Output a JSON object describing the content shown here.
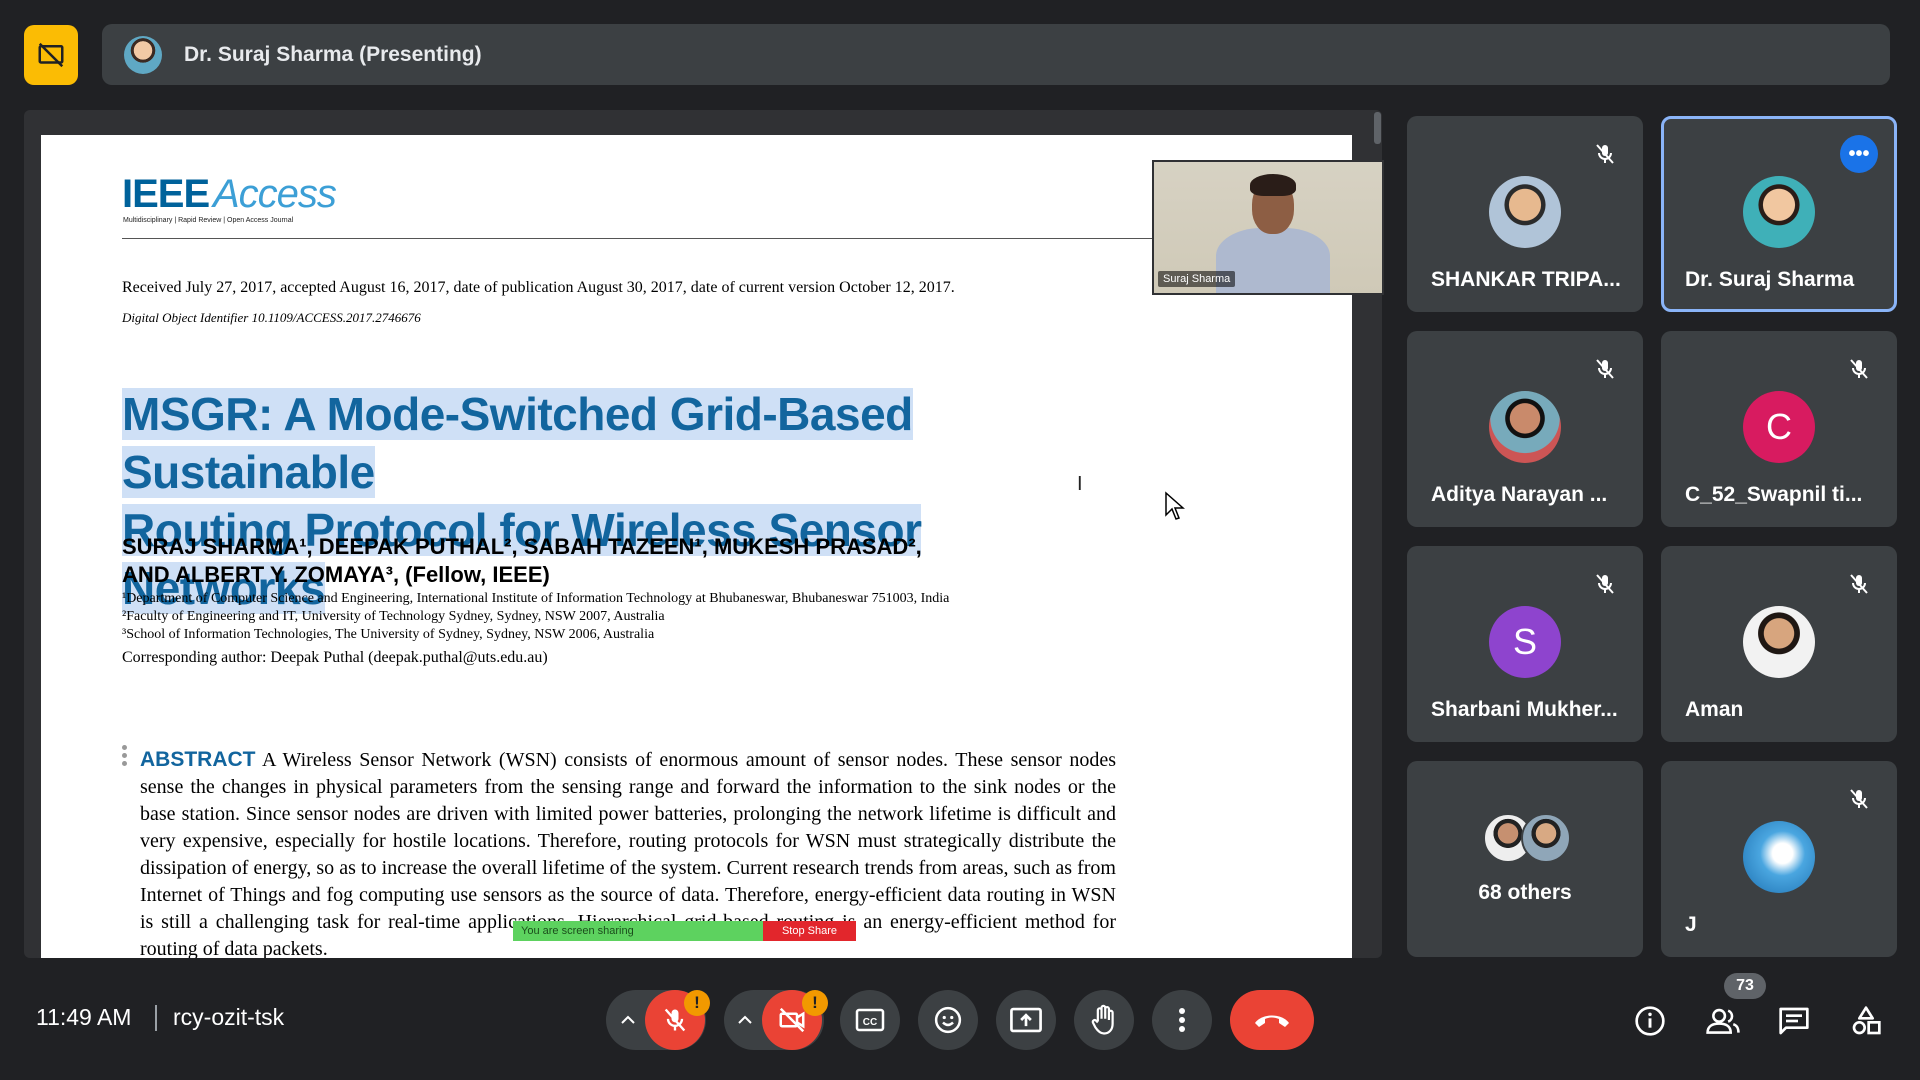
{
  "presenter": {
    "label": "Dr. Suraj Sharma (Presenting)"
  },
  "document": {
    "logo_ieee": "IEEE",
    "logo_access": "Access",
    "logo_tagline": "Multidisciplinary | Rapid Review | Open Access Journal",
    "received": "Received July 27, 2017, accepted August 16, 2017, date of publication August 30, 2017, date of current version October 12, 2017.",
    "doi": "Digital Object Identifier 10.1109/ACCESS.2017.2746676",
    "title_line1": "MSGR: A Mode-Switched Grid-Based Sustainable",
    "title_line2": "Routing Protocol for Wireless Sensor Networks",
    "authors_line1": "SURAJ SHARMA¹, DEEPAK PUTHAL², SABAH TAZEEN¹, MUKESH PRASAD²,",
    "authors_line2": "AND ALBERT Y. ZOMAYA³, (Fellow, IEEE)",
    "affiliations": [
      "¹Department of Computer Science and Engineering, International Institute of Information Technology at Bhubaneswar, Bhubaneswar 751003, India",
      "²Faculty of Engineering and IT, University of Technology Sydney, Sydney, NSW 2007, Australia",
      "³School of Information Technologies, The University of Sydney, Sydney, NSW 2006, Australia"
    ],
    "corresponding": "Corresponding author: Deepak Puthal (deepak.puthal@uts.edu.au)",
    "abstract_heading": "ABSTRACT",
    "abstract_text": "A Wireless Sensor Network (WSN) consists of enormous amount of sensor nodes. These sensor nodes sense the changes in physical parameters from the sensing range and forward the information to the sink nodes or the base station. Since sensor nodes are driven with limited power batteries, prolonging the network lifetime is difficult and very expensive, especially for hostile locations. Therefore, routing protocols for WSN must strategically distribute the dissipation of energy, so as to increase the overall lifetime of the system. Current research trends from areas, such as from Internet of Things and fog computing use sensors as the source of data. Therefore, energy-efficient data routing in WSN is still a challenging task for real-time applications. Hierarchical grid-based routing is an energy-efficient method for routing of data packets."
  },
  "share_bar": {
    "sharing": "You are screen sharing",
    "stop": "Stop Share"
  },
  "selfview": {
    "label": "Suraj Sharma"
  },
  "participants": [
    {
      "name": "SHANKAR TRIPA...",
      "muted": true
    },
    {
      "name": "Dr. Suraj Sharma",
      "muted": false,
      "active": true
    },
    {
      "name": "Aditya Narayan ...",
      "muted": true
    },
    {
      "name": "C_52_Swapnil ti...",
      "muted": true,
      "initial": "C",
      "color": "#d81b60"
    },
    {
      "name": "Sharbani Mukher...",
      "muted": true,
      "initial": "S",
      "color": "#8e44ce"
    },
    {
      "name": "Aman",
      "muted": true
    },
    {
      "name": "68 others"
    },
    {
      "name": "J",
      "muted": true
    }
  ],
  "bottom": {
    "time": "11:49 AM",
    "meeting_code": "rcy-ozit-tsk",
    "participant_count": "73",
    "warn_glyph": "!"
  },
  "colors": {
    "accent": "#8ab4f8",
    "end_call": "#ea4335",
    "present_badge": "#fbbc04",
    "warning": "#f29900"
  }
}
